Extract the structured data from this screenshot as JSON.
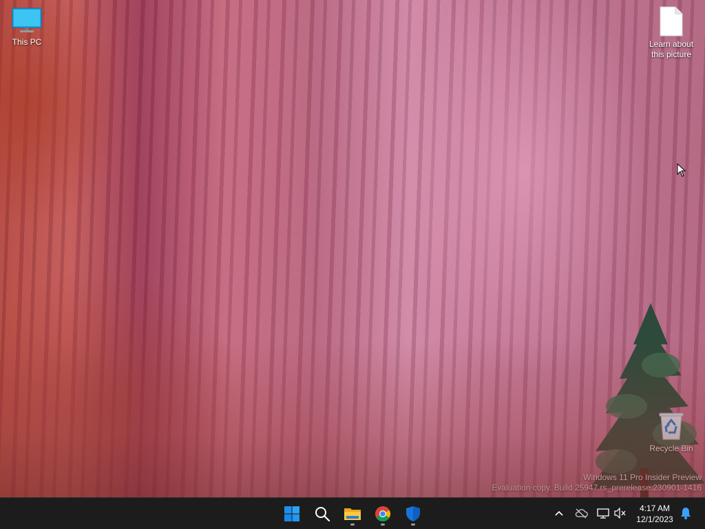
{
  "desktop": {
    "icons": [
      {
        "label": "This PC",
        "icon": "monitor-icon"
      },
      {
        "label": "Learn about this picture",
        "icon": "document-icon"
      },
      {
        "label": "Recycle Bin",
        "icon": "recycle-bin-icon"
      }
    ]
  },
  "watermark": {
    "line1": "Windows 11 Pro Insider Preview",
    "line2": "Evaluation copy. Build 25947.rs_prerelease.230901-1416"
  },
  "taskbar": {
    "apps": [
      {
        "icon": "windows-start-icon",
        "running": false
      },
      {
        "icon": "search-icon",
        "running": false
      },
      {
        "icon": "file-explorer-icon",
        "running": true
      },
      {
        "icon": "chrome-icon",
        "running": true
      },
      {
        "icon": "defender-shield-icon",
        "running": true
      }
    ],
    "tray": {
      "icons": [
        "chevron-up-icon",
        "onedrive-offline-icon",
        "network-icon",
        "volume-muted-icon",
        "notification-bell-icon"
      ]
    },
    "clock": {
      "time": "4:17 AM",
      "date": "12/1/2023"
    }
  },
  "colors": {
    "taskbar_bg": "#1c1c1c",
    "start_blue": "#1e8ff0",
    "bell_blue": "#3aa0ff"
  }
}
